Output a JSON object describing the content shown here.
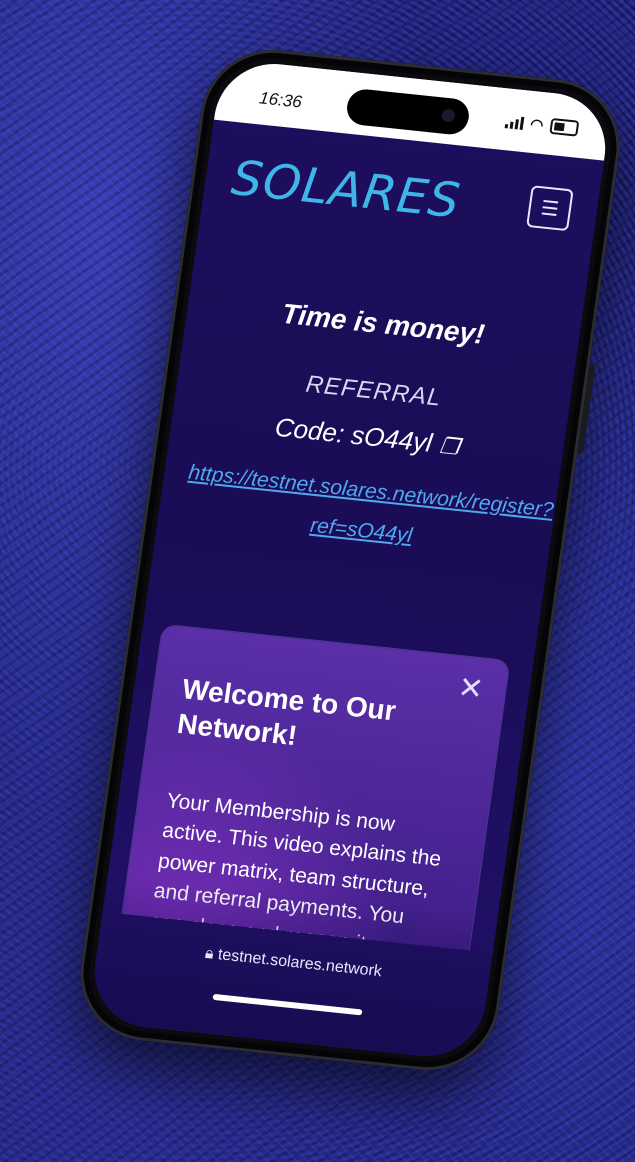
{
  "status_bar": {
    "time": "16:36"
  },
  "header": {
    "logo_text": "SOLARES",
    "menu_icon": "hamburger-menu-icon"
  },
  "main": {
    "headline": "Time is money!",
    "referral_label": "REFERRAL",
    "code_text": "Code: sO44yl",
    "copy_icon": "copy-icon",
    "referral_link": "https://testnet.solares.network/register?ref=sO44yl"
  },
  "modal": {
    "title": "Welcome to Our Network!",
    "body": "Your Membership is now active. This video explains the power matrix, team structure, and referral payments. You can close and reopen it anytime in the “Your Data” section.",
    "close_icon": "close-icon"
  },
  "browser": {
    "url": "testnet.solares.network"
  },
  "colors": {
    "logo": "#3fb6e8",
    "link": "#4fa8f0",
    "screen_bg": "#1d0f5e",
    "modal_bg": "#5a2fa8"
  }
}
